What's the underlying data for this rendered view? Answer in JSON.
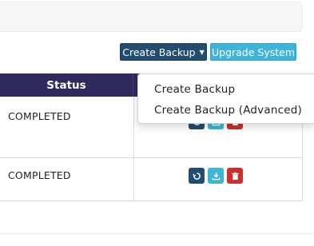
{
  "toolbar": {
    "create_backup_label": "Create Backup",
    "upgrade_label": "Upgrade System"
  },
  "table": {
    "columns": [
      "Status"
    ],
    "rows": [
      {
        "status": "COMPLETED"
      },
      {
        "status": "COMPLETED"
      }
    ],
    "row_actions": [
      "restore-icon",
      "download-icon",
      "delete-icon"
    ]
  },
  "dropdown": {
    "items": [
      "Create Backup",
      "Create Backup (Advanced)"
    ]
  },
  "colors": {
    "header_bg": "#2e2a5e",
    "primary_button": "#224d70",
    "info_button": "#3fb4d8",
    "danger_button": "#c9302c"
  }
}
